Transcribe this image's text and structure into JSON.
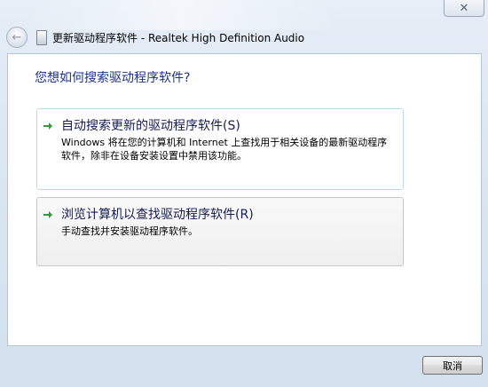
{
  "window": {
    "close_glyph": "✕",
    "title": "更新驱动程序软件 - Realtek High Definition Audio",
    "back_icon": "back-arrow-icon",
    "device_icon": "device-icon"
  },
  "main": {
    "question": "您想如何搜索驱动程序软件?",
    "options": [
      {
        "title": "自动搜索更新的驱动程序软件(S)",
        "description": "Windows 将在您的计算机和 Internet 上查找用于相关设备的最新驱动程序软件，除非在设备安装设置中禁用该功能。",
        "icon": "green-arrow-icon"
      },
      {
        "title": "浏览计算机以查找驱动程序软件(R)",
        "description": "手动查找并安装驱动程序软件。",
        "icon": "green-arrow-icon"
      }
    ]
  },
  "footer": {
    "cancel_label": "取消"
  },
  "colors": {
    "heading": "#1e3287",
    "option_title": "#151c55",
    "arrow_green": "#2e9c2e",
    "option_highlight_border": "#b8dcec"
  }
}
